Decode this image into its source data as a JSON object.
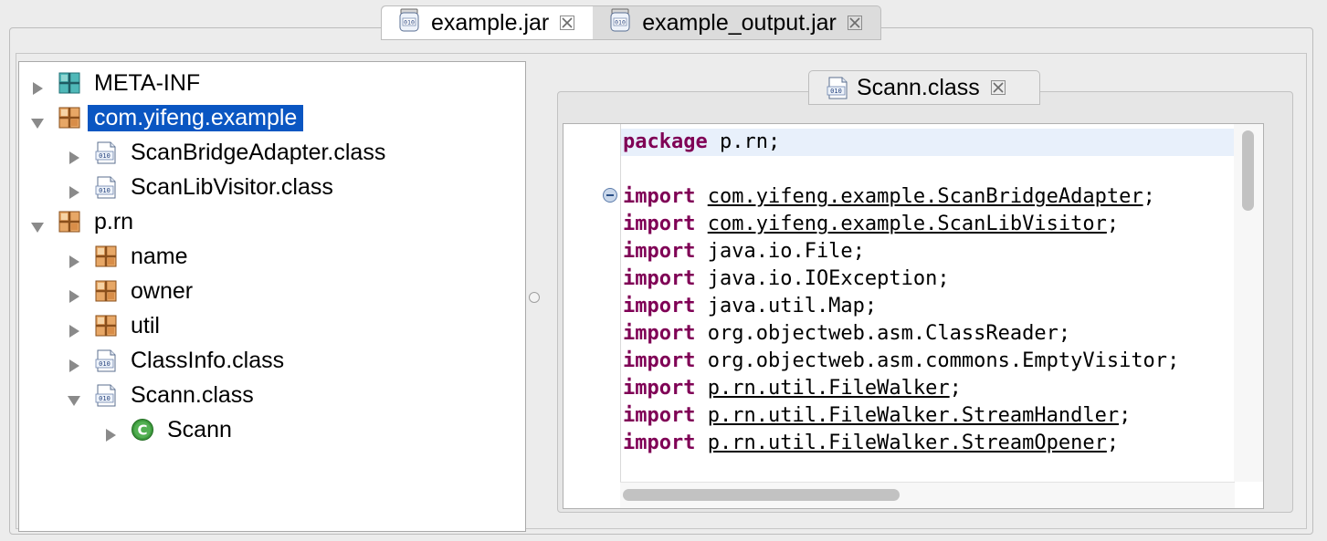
{
  "top_tabs": [
    {
      "label": "example.jar",
      "active": true
    },
    {
      "label": "example_output.jar",
      "active": false
    }
  ],
  "tree": [
    {
      "label": "META-INF",
      "icon": "folder-icon",
      "arrow": "right",
      "indent": 0
    },
    {
      "label": "com.yifeng.example",
      "icon": "package-icon",
      "arrow": "down",
      "indent": 0,
      "selected": true
    },
    {
      "label": "ScanBridgeAdapter.class",
      "icon": "class-file-icon",
      "arrow": "right",
      "indent": 1
    },
    {
      "label": "ScanLibVisitor.class",
      "icon": "class-file-icon",
      "arrow": "right",
      "indent": 1
    },
    {
      "label": "p.rn",
      "icon": "package-icon",
      "arrow": "down",
      "indent": 0
    },
    {
      "label": "name",
      "icon": "package-icon",
      "arrow": "right",
      "indent": 1
    },
    {
      "label": "owner",
      "icon": "package-icon",
      "arrow": "right",
      "indent": 1
    },
    {
      "label": "util",
      "icon": "package-icon",
      "arrow": "right",
      "indent": 1
    },
    {
      "label": "ClassInfo.class",
      "icon": "class-file-icon",
      "arrow": "right",
      "indent": 1
    },
    {
      "label": "Scann.class",
      "icon": "class-file-icon",
      "arrow": "down",
      "indent": 1
    },
    {
      "label": "Scann",
      "icon": "class-icon",
      "arrow": "right",
      "indent": 2
    }
  ],
  "editor_tab": {
    "label": "Scann.class"
  },
  "code": [
    {
      "kw": "package",
      "rest": " p.rn;",
      "underline": false
    },
    {
      "kw": "",
      "rest": "",
      "underline": false
    },
    {
      "kw": "import",
      "rest": "com.yifeng.example.ScanBridgeAdapter",
      "underline": true
    },
    {
      "kw": "import",
      "rest": "com.yifeng.example.ScanLibVisitor",
      "underline": true
    },
    {
      "kw": "import",
      "rest": "java.io.File",
      "underline": false
    },
    {
      "kw": "import",
      "rest": "java.io.IOException",
      "underline": false
    },
    {
      "kw": "import",
      "rest": "java.util.Map",
      "underline": false
    },
    {
      "kw": "import",
      "rest": "org.objectweb.asm.ClassReader",
      "underline": false
    },
    {
      "kw": "import",
      "rest": "org.objectweb.asm.commons.EmptyVisitor",
      "underline": false
    },
    {
      "kw": "import",
      "rest": "p.rn.util.FileWalker",
      "underline": true
    },
    {
      "kw": "import",
      "rest": "p.rn.util.FileWalker.StreamHandler",
      "underline": true
    },
    {
      "kw": "import",
      "rest": "p.rn.util.FileWalker.StreamOpener",
      "underline": true
    }
  ],
  "colors": {
    "keyword": "#7f0055",
    "selection": "#0a56c2",
    "current_line": "#e8f0fb"
  }
}
